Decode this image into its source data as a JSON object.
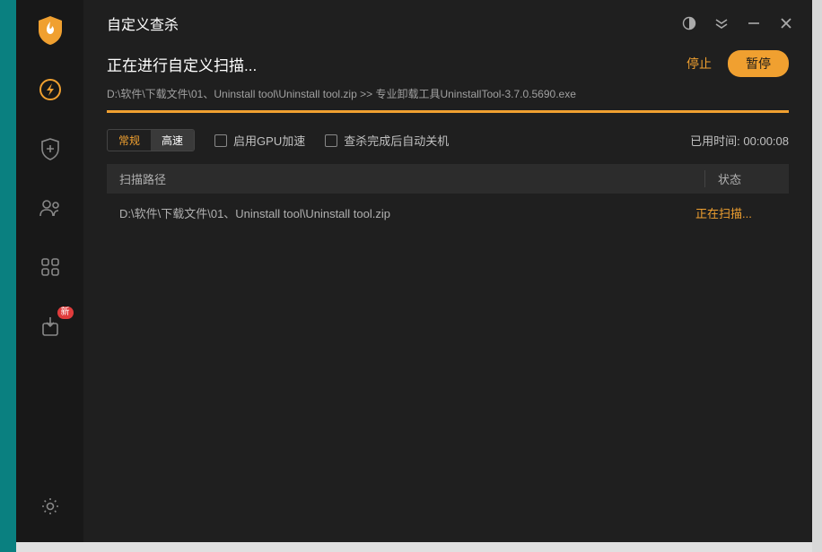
{
  "window": {
    "title": "自定义查杀"
  },
  "scan": {
    "status_title": "正在进行自定义扫描...",
    "current_path": "D:\\软件\\下载文件\\01、Uninstall tool\\Uninstall tool.zip >> 专业卸载工具UninstallTool-3.7.0.5690.exe",
    "stop_label": "停止",
    "pause_label": "暂停"
  },
  "options": {
    "speed_normal": "常规",
    "speed_fast": "高速",
    "gpu_accel": "启用GPU加速",
    "auto_shutdown": "查杀完成后自动关机"
  },
  "timer": {
    "label": "已用时间:",
    "value": "00:00:08"
  },
  "table": {
    "header_path": "扫描路径",
    "header_status": "状态",
    "rows": [
      {
        "path": "D:\\软件\\下载文件\\01、Uninstall tool\\Uninstall tool.zip",
        "status": "正在扫描..."
      }
    ]
  },
  "sidebar": {
    "badge_new": "新"
  }
}
